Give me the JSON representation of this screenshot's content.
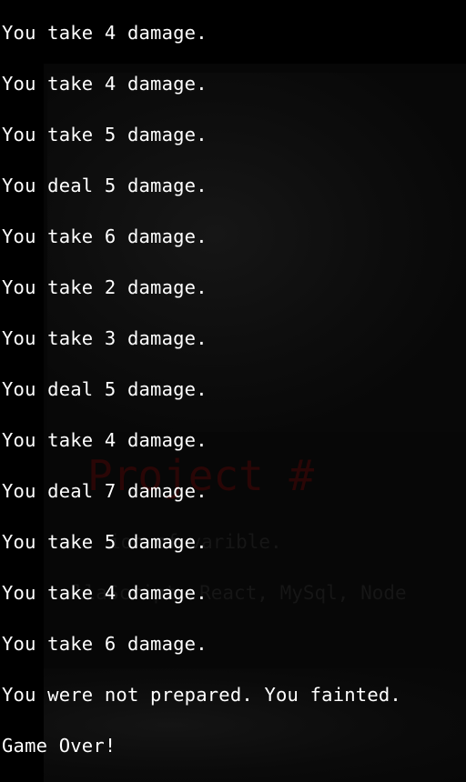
{
  "background": {
    "title": "Project #",
    "description": "ion of varible.",
    "tech": "llaScript, React, MySql, Node"
  },
  "terminal": {
    "lines": [
      "You take 4 damage.",
      "You take 4 damage.",
      "You take 5 damage.",
      "You deal 5 damage.",
      "You take 6 damage.",
      "You take 2 damage.",
      "You take 3 damage.",
      "You deal 5 damage.",
      "You take 4 damage.",
      "You deal 7 damage.",
      "You take 5 damage.",
      "You take 4 damage.",
      "You take 6 damage.",
      "You were not prepared. You fainted.",
      "Game Over!"
    ]
  },
  "colors": {
    "background": "#000000",
    "text": "#ffffff",
    "title_faint": "#2a0606"
  }
}
